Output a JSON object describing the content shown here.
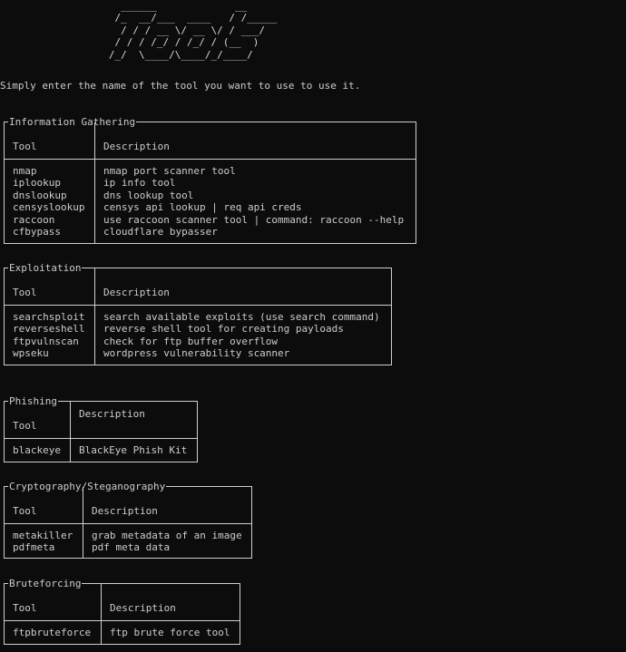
{
  "banner": "     ______             __\n    /_  __/___  ____   / /_____\n     / / / __ \\/ __ \\/ / ___/\n    / / / /_/ / /_/ / (__  )\n   /_/  \\____/\\____/_/____/",
  "intro": "Simply enter the name of the tool you want to use to use it.",
  "sections": [
    {
      "title": "Information Gathering",
      "header": {
        "tool": "Tool",
        "description": "Description"
      },
      "rows": [
        {
          "tool": "nmap",
          "description": "nmap port scanner tool"
        },
        {
          "tool": "iplookup",
          "description": "ip info tool"
        },
        {
          "tool": "dnslookup",
          "description": "dns lookup tool"
        },
        {
          "tool": "censyslookup",
          "description": "censys api lookup | req api creds"
        },
        {
          "tool": "raccoon",
          "description": "use raccoon scanner tool | command: raccoon --help"
        },
        {
          "tool": "cfbypass",
          "description": "cloudflare bypasser"
        }
      ]
    },
    {
      "title": "Exploitation",
      "header": {
        "tool": "Tool",
        "description": "Description"
      },
      "rows": [
        {
          "tool": "searchsploit",
          "description": "search available exploits (use search command)"
        },
        {
          "tool": "reverseshell",
          "description": "reverse shell tool for creating payloads"
        },
        {
          "tool": "ftpvulnscan",
          "description": "check for ftp buffer overflow"
        },
        {
          "tool": "wpseku",
          "description": "wordpress vulnerability scanner"
        }
      ]
    },
    {
      "title": "Phishing",
      "header": {
        "tool": "Tool",
        "description": "Description"
      },
      "rows": [
        {
          "tool": "blackeye",
          "description": "BlackEye Phish Kit"
        }
      ]
    },
    {
      "title": "Cryptography/Steganography",
      "header": {
        "tool": "Tool",
        "description": "Description"
      },
      "rows": [
        {
          "tool": "metakiller",
          "description": "grab metadata of an image"
        },
        {
          "tool": "pdfmeta",
          "description": "pdf meta data"
        }
      ]
    },
    {
      "title": "Bruteforcing",
      "header": {
        "tool": "Tool",
        "description": "Description"
      },
      "rows": [
        {
          "tool": "ftpbruteforce",
          "description": "ftp brute force tool"
        }
      ]
    }
  ],
  "colors": {
    "background": "#0c0c0c",
    "text": "#cccccc",
    "border": "#cfcfcf"
  }
}
